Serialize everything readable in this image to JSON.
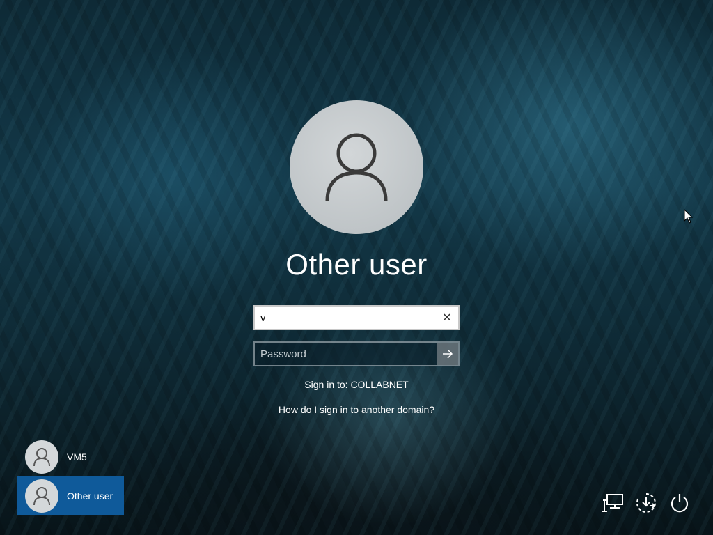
{
  "login": {
    "account_name": "Other user",
    "username_value": "v",
    "clear_glyph": "✕",
    "password_placeholder": "Password",
    "signin_target": "Sign in to: COLLABNET",
    "help_link": "How do I sign in to another domain?"
  },
  "users": [
    {
      "label": "VM5",
      "selected": false,
      "icon": "user-icon"
    },
    {
      "label": "Other user",
      "selected": true,
      "icon": "user-icon"
    }
  ],
  "system_icons": [
    "network-icon",
    "accessibility-icon",
    "power-icon"
  ],
  "colors": {
    "selected_tile": "#0f5a9a",
    "avatar_bg": "#c4c9cc",
    "text": "#ffffff"
  }
}
